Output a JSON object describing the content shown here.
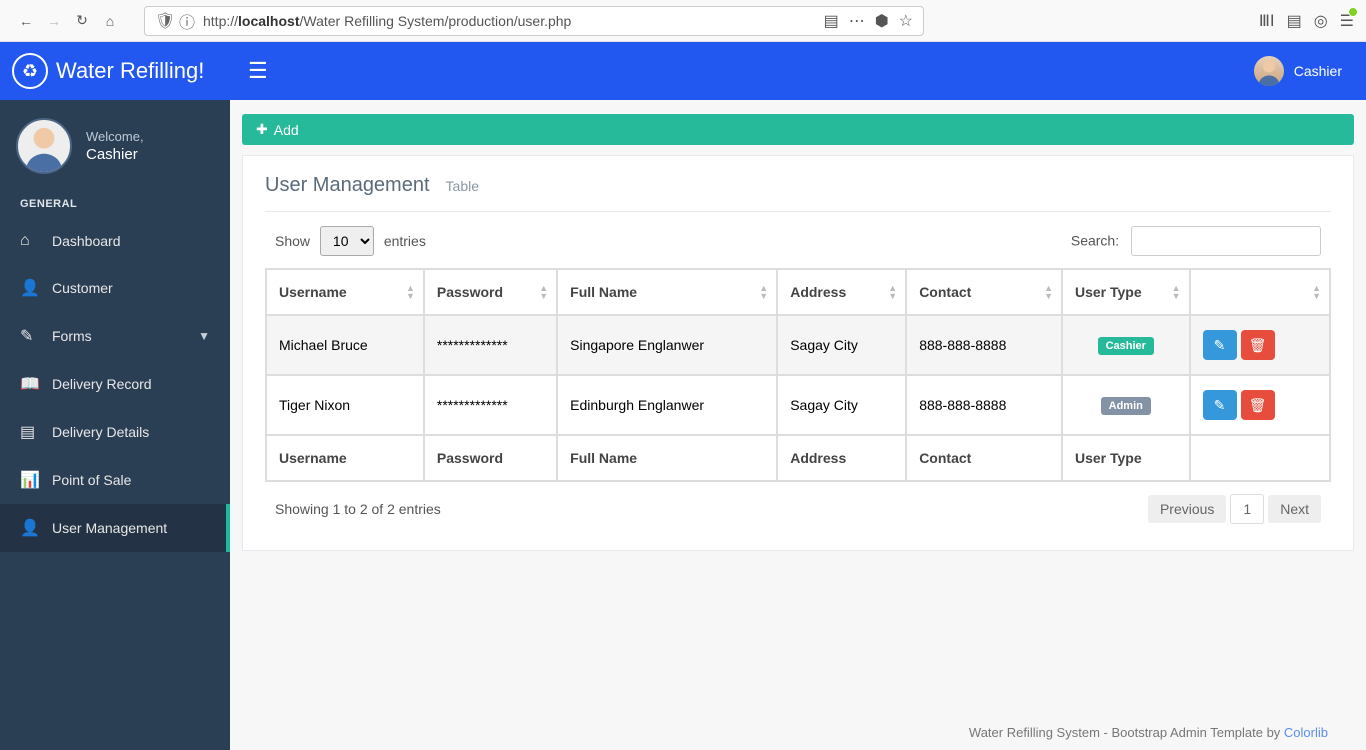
{
  "browser": {
    "url_prefix": "http://",
    "url_host": "localhost",
    "url_path": "/Water Refilling System/production/user.php"
  },
  "header": {
    "brand": "Water Refilling!",
    "user_label": "Cashier"
  },
  "sidebar": {
    "welcome": "Welcome,",
    "username": "Cashier",
    "section": "GENERAL",
    "items": [
      {
        "label": "Dashboard"
      },
      {
        "label": "Customer"
      },
      {
        "label": "Forms"
      },
      {
        "label": "Delivery Record"
      },
      {
        "label": "Delivery Details"
      },
      {
        "label": "Point of Sale"
      },
      {
        "label": "User Management"
      }
    ]
  },
  "main": {
    "add_label": "Add",
    "panel_title": "User Management",
    "panel_sub": "Table",
    "show_label": "Show",
    "entries_label": "entries",
    "page_size": "10",
    "search_label": "Search:",
    "search_value": "",
    "columns": [
      "Username",
      "Password",
      "Full Name",
      "Address",
      "Contact",
      "User Type",
      ""
    ],
    "footer_columns": [
      "Username",
      "Password",
      "Full Name",
      "Address",
      "Contact",
      "User Type",
      ""
    ],
    "rows": [
      {
        "username": "Michael Bruce",
        "password": "*************",
        "fullname": "Singapore Englanwer",
        "address": "Sagay City",
        "contact": "888-888-8888",
        "usertype": "Cashier",
        "usertype_class": "badge-green"
      },
      {
        "username": "Tiger Nixon",
        "password": "*************",
        "fullname": "Edinburgh Englanwer",
        "address": "Sagay City",
        "contact": "888-888-8888",
        "usertype": "Admin",
        "usertype_class": "badge-gray"
      }
    ],
    "info": "Showing 1 to 2 of 2 entries",
    "pagination": {
      "prev": "Previous",
      "page": "1",
      "next": "Next"
    },
    "footer_text": "Water Refilling System - Bootstrap Admin Template by ",
    "footer_link": "Colorlib"
  }
}
